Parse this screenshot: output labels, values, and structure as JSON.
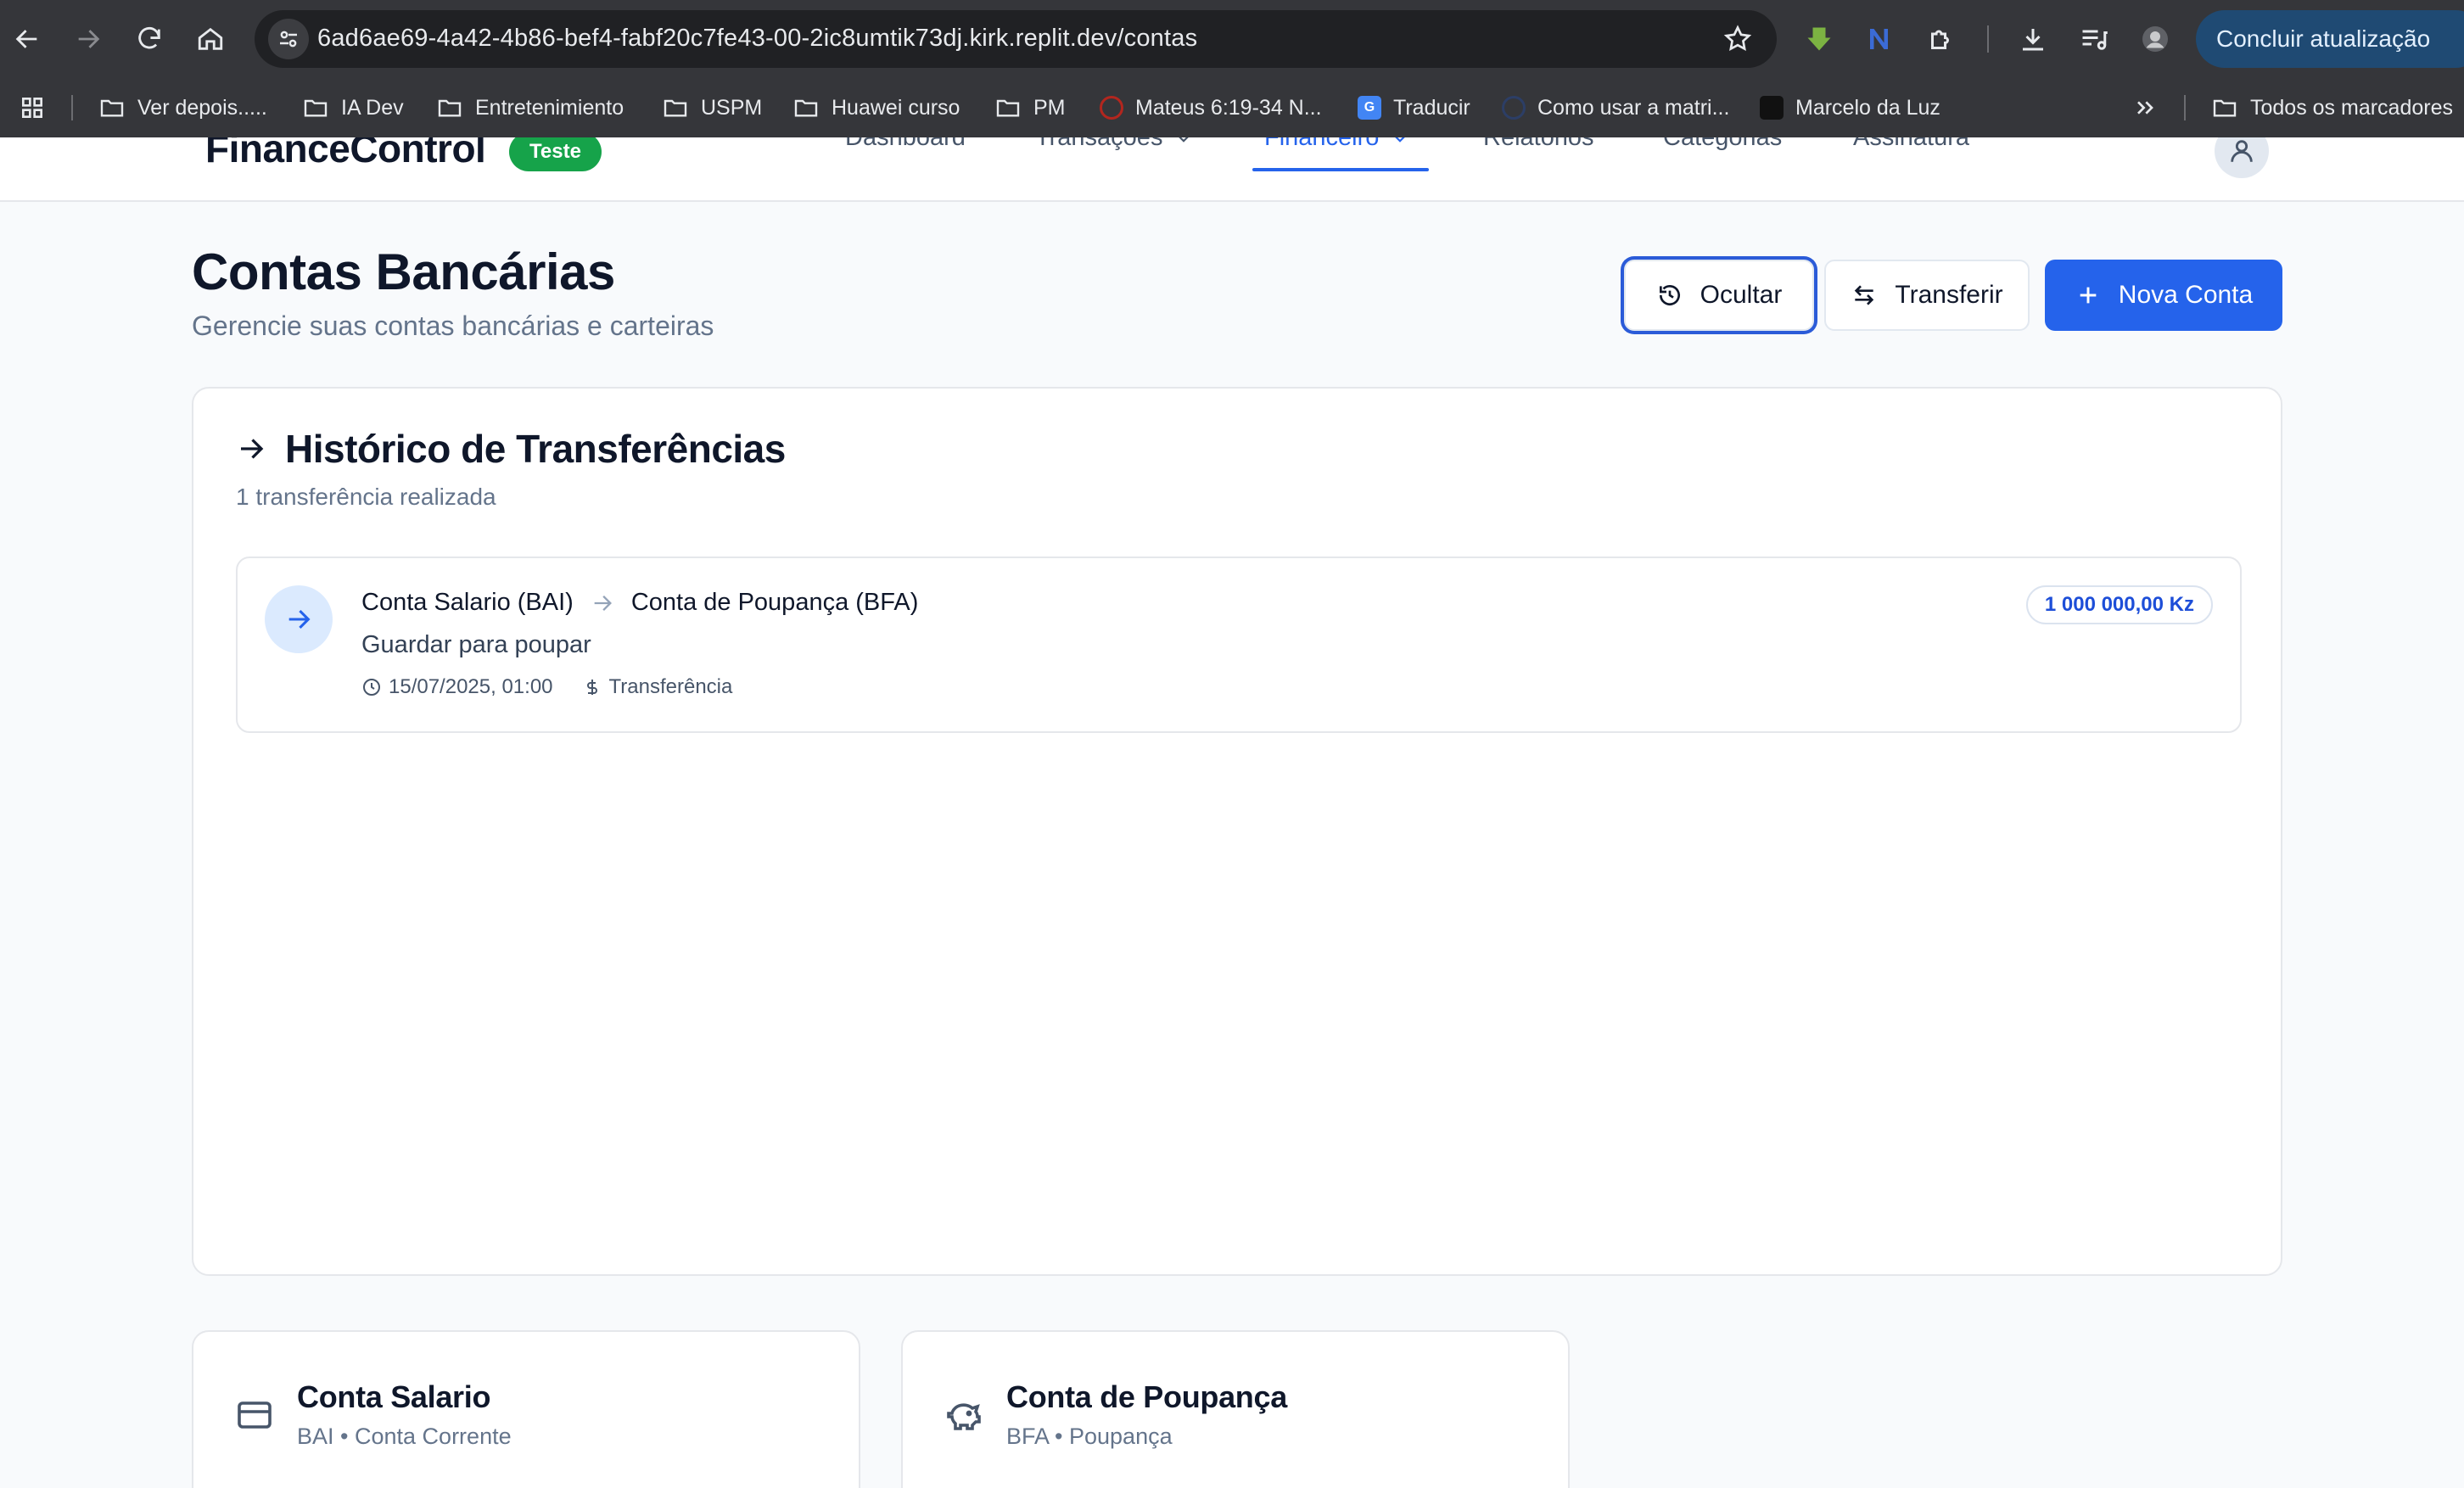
{
  "browser": {
    "url": "6ad6ae69-4a42-4b86-bef4-fabf20c7fe43-00-2ic8umtik73dj.kirk.replit.dev/contas",
    "update_button": "Concluir atualização",
    "bookmarks": [
      {
        "label": "Ver depois.....",
        "icon": "folder-icon"
      },
      {
        "label": "IA Dev",
        "icon": "folder-icon"
      },
      {
        "label": "Entretenimiento",
        "icon": "folder-icon"
      },
      {
        "label": "USPM",
        "icon": "folder-icon"
      },
      {
        "label": "Huawei curso",
        "icon": "folder-icon"
      },
      {
        "label": "PM",
        "icon": "folder-icon"
      },
      {
        "label": "Mateus 6:19-34 N...",
        "icon": "site-favicon"
      },
      {
        "label": "Traducir",
        "icon": "translate-favicon"
      },
      {
        "label": "Como usar a matri...",
        "icon": "site-favicon"
      },
      {
        "label": "Marcelo da Luz",
        "icon": "site-favicon"
      }
    ],
    "all_bookmarks": "Todos os marcadores"
  },
  "app": {
    "brand": "FinanceControl",
    "badge": "Teste",
    "nav": [
      {
        "label": "Dashboard"
      },
      {
        "label": "Transações"
      },
      {
        "label": "Financeiro"
      },
      {
        "label": "Relatórios"
      },
      {
        "label": "Categorias"
      },
      {
        "label": "Assinatura"
      }
    ],
    "accent_color": "#2563eb",
    "badge_color": "#16a34a"
  },
  "page": {
    "title": "Contas Bancárias",
    "subtitle": "Gerencie suas contas bancárias e carteiras",
    "buttons": {
      "hide": "Ocultar",
      "transfer": "Transferir",
      "new_account": "Nova Conta"
    }
  },
  "history": {
    "title": "Histórico de Transferências",
    "count_text": "1 transferência realizada",
    "transfers": [
      {
        "from": "Conta Salario (BAI)",
        "to": "Conta de Poupança (BFA)",
        "description": "Guardar para poupar",
        "datetime": "15/07/2025, 01:00",
        "type": "Transferência",
        "amount": "1 000 000,00 Kz"
      }
    ]
  },
  "accounts": [
    {
      "name": "Conta Salario",
      "bank": "BAI",
      "kind": "Conta Corrente",
      "icon": "credit-card-icon"
    },
    {
      "name": "Conta de Poupança",
      "bank": "BFA",
      "kind": "Poupança",
      "icon": "piggy-bank-icon"
    }
  ]
}
